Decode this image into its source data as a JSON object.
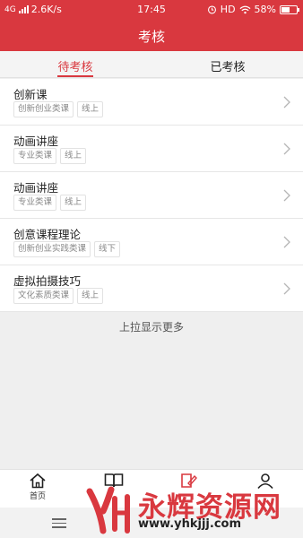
{
  "status_bar": {
    "network": "4G",
    "speed": "2.6K/s",
    "time": "17:45",
    "hd": "HD",
    "battery": "58%",
    "battery_level": 0.58
  },
  "header": {
    "title": "考核"
  },
  "tabs": [
    {
      "label": "待考核",
      "active": true
    },
    {
      "label": "已考核",
      "active": false
    }
  ],
  "courses": [
    {
      "title": "创新课",
      "tags": [
        "创新创业类课",
        "线上"
      ]
    },
    {
      "title": "动画讲座",
      "tags": [
        "专业类课",
        "线上"
      ]
    },
    {
      "title": "动画讲座",
      "tags": [
        "专业类课",
        "线上"
      ]
    },
    {
      "title": "创意课程理论",
      "tags": [
        "创新创业实践类课",
        "线下"
      ]
    },
    {
      "title": "虚拟拍摄技巧",
      "tags": [
        "文化素质类课",
        "线上"
      ]
    }
  ],
  "load_more": "上拉显示更多",
  "bottom_nav": [
    {
      "label": "首页",
      "icon": "home-icon"
    },
    {
      "label": "",
      "icon": "book-icon"
    },
    {
      "label": "",
      "icon": "edit-icon"
    },
    {
      "label": "",
      "icon": "user-icon"
    }
  ],
  "watermark": {
    "brand": "永辉资源网",
    "url": "www.yhkjjj.com",
    "logo_text": "YH"
  },
  "colors": {
    "accent": "#d9383f",
    "background": "#efefef"
  }
}
